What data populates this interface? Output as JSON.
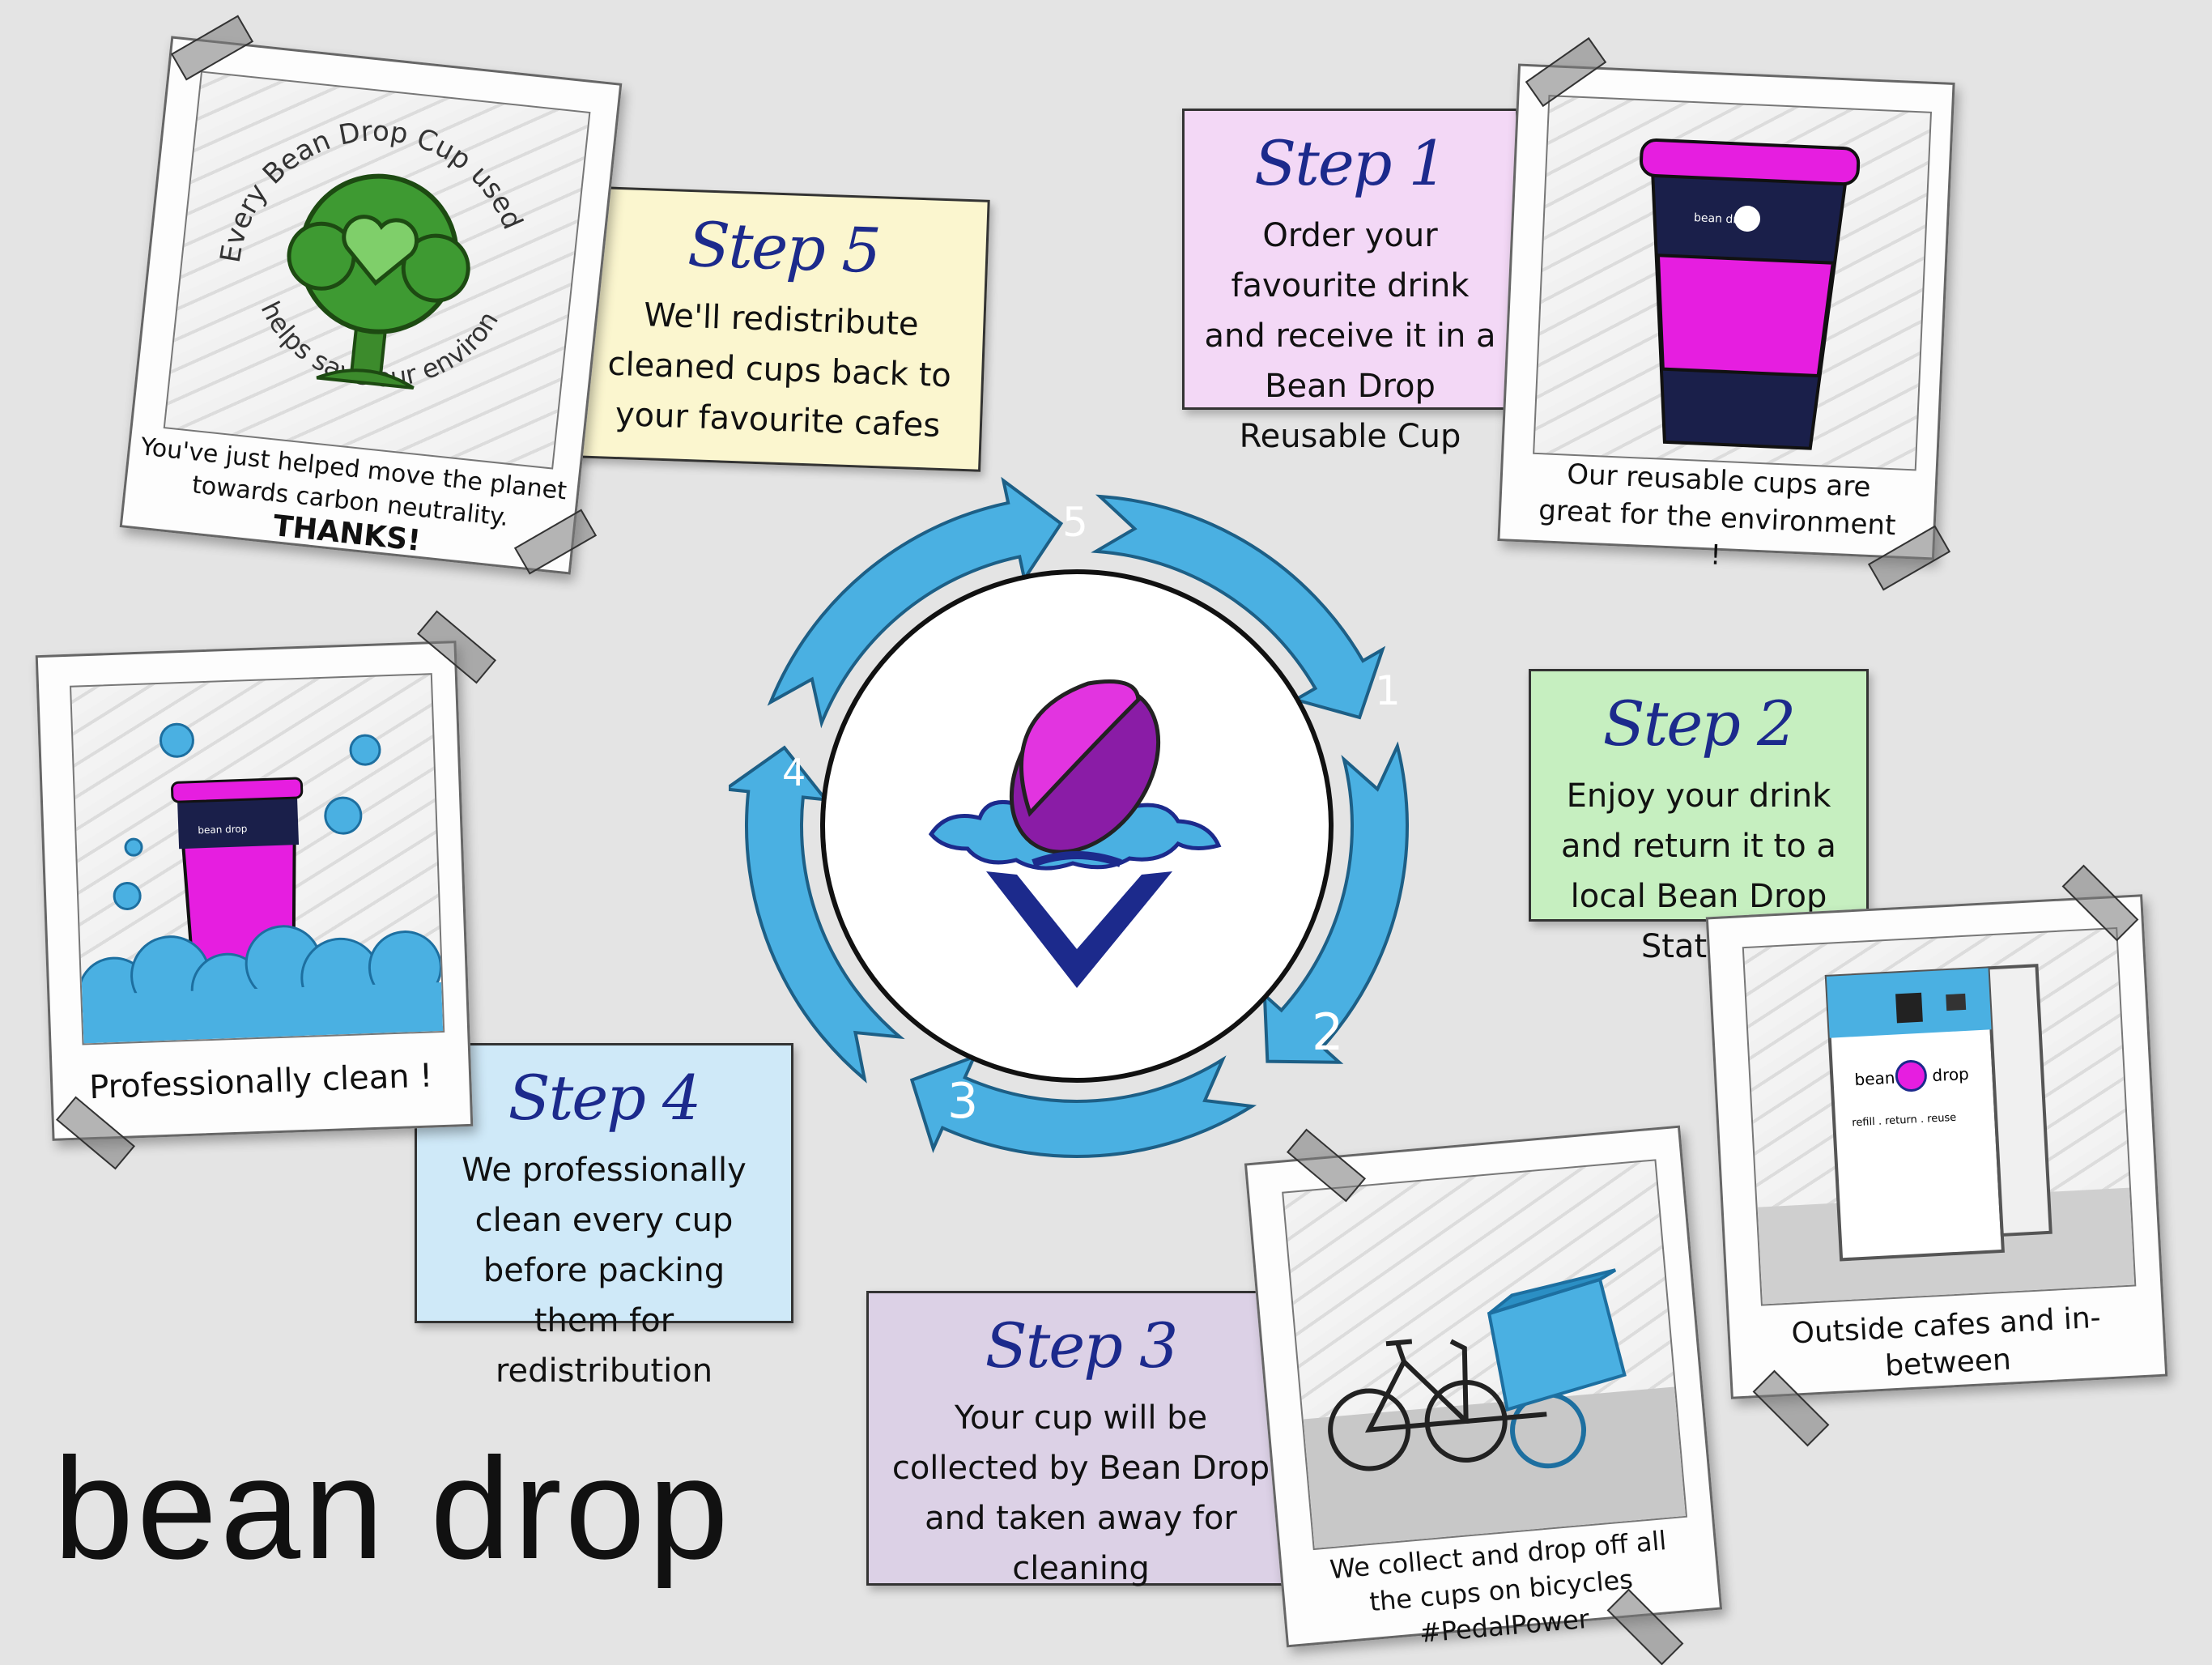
{
  "brand": {
    "wordmark": "bean drop"
  },
  "cycle": {
    "numbers": [
      "5",
      "1",
      "2",
      "3",
      "4"
    ],
    "arrow_color": "#4ab0e2",
    "logo_colors": {
      "bean_top": "#e234e0",
      "bean_bottom": "#8a1ca6",
      "splash": "#4ab0e2",
      "cone": "#1c2a8c"
    }
  },
  "steps": [
    {
      "title": "Step 1",
      "text": "Order your favourite drink and receive it in a Bean Drop Reusable Cup",
      "color": "#f3d8f6"
    },
    {
      "title": "Step 2",
      "text": "Enjoy your drink and return it to a local Bean Drop Station",
      "color": "#c6efc0"
    },
    {
      "title": "Step 3",
      "text": "Your cup will be collected by Bean Drop and taken away for cleaning",
      "color": "#dcd1e6"
    },
    {
      "title": "Step 4",
      "text": "We professionally clean every cup before packing them for redistribution",
      "color": "#cfe9f8"
    },
    {
      "title": "Step 5",
      "text": "We'll redistribute cleaned cups back to your favourite cafes",
      "color": "#fbf6cf"
    }
  ],
  "polaroids": {
    "tree": {
      "arc_top": "Every Bean Drop Cup used",
      "arc_bottom": "helps save our environment",
      "caption_line1": "You've just helped move the planet",
      "caption_line2": "towards carbon neutrality.",
      "caption_thanks": "THANKS!"
    },
    "cup": {
      "caption": "Our reusable cups are great for the environment !",
      "label": "bean drop"
    },
    "clean": {
      "caption": "Professionally clean !",
      "label": "bean drop"
    },
    "station": {
      "caption": "Outside cafes and in-between",
      "label_left": "bean",
      "label_right": "drop",
      "tagline": "refill . return . reuse"
    },
    "bike": {
      "caption": "We collect and drop off all the cups on bicycles #PedalPower"
    }
  }
}
